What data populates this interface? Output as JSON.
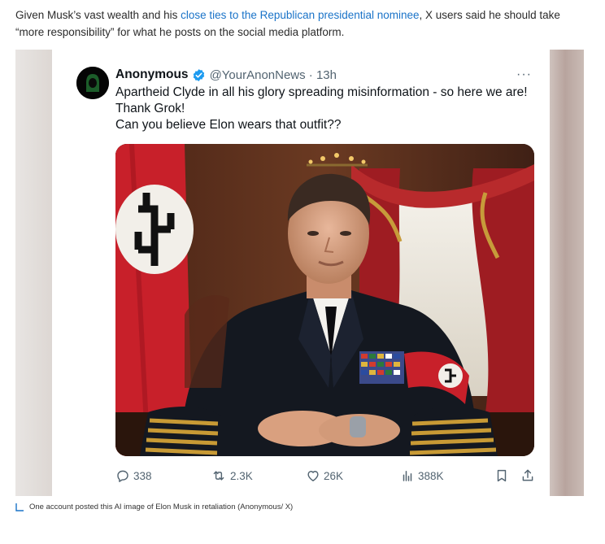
{
  "article": {
    "intro_before": "Given Musk’s vast wealth and his ",
    "intro_link": "close ties to the Republican presidential nominee",
    "intro_after": ", X users said he should take “more responsibility” for what he posts on the social media platform."
  },
  "tweet": {
    "display_name": "Anonymous",
    "handle_time": "@YourAnonNews · 13h",
    "text_lines": [
      "Apartheid Clyde in all his glory spreading misinformation - so here we are!",
      "Thank Grok!",
      "Can you believe Elon wears that outfit??"
    ],
    "more": "···",
    "actions": {
      "replies": "338",
      "reposts": "2.3K",
      "likes": "26K",
      "views": "388K"
    }
  },
  "caption": {
    "text": "One account posted this AI image of Elon Musk in retaliation (Anonymous/ X)"
  },
  "icons": {
    "verified": "verified-badge-icon",
    "reply": "reply-icon",
    "repost": "repost-icon",
    "like": "heart-icon",
    "views": "views-icon",
    "bookmark": "bookmark-icon",
    "share": "share-icon"
  },
  "colors": {
    "link": "#1a73c8",
    "verified": "#1d9bf0",
    "muted": "#536471"
  }
}
